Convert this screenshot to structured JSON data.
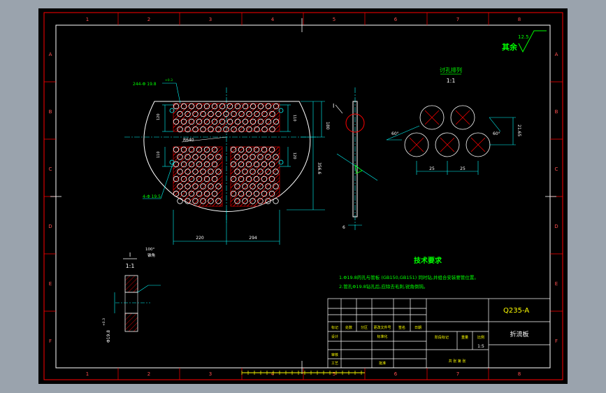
{
  "colors": {
    "background": "#000000",
    "outer_frame": "#ff0000",
    "drawing": "#ffffff",
    "dimension": "#00ffff",
    "text_green": "#00ff00",
    "text_yellow": "#ffff00",
    "hatch": "#ff0000",
    "center_line": "#00ffff",
    "page": "#9aa3ad"
  },
  "border": {
    "col_labels_top": [
      "1",
      "2",
      "3",
      "4",
      "5",
      "6",
      "7",
      "8"
    ],
    "col_labels_bottom": [
      "1",
      "2",
      "3",
      "4",
      "5",
      "6",
      "7",
      "8"
    ],
    "row_labels_left": [
      "A",
      "B",
      "C",
      "D",
      "E",
      "F"
    ],
    "row_labels_right": [
      "A",
      "B",
      "C",
      "D",
      "E",
      "F"
    ]
  },
  "roughness": {
    "prefix": "其余",
    "value": "12.5"
  },
  "main_view": {
    "callout_holes_top": "244-Φ 19.8",
    "callout_holes_top_tol": "+0.3",
    "callout_holes_bottom": "4-Φ 19.5",
    "center_label": "R640",
    "dim_width_left": "220",
    "dim_width_right": "294",
    "dim_height_right": "180",
    "dim_height_total": "356.6",
    "dim_small_1": "120",
    "dim_small_2": "110",
    "dim_small_3": "110",
    "dim_small_4": "120"
  },
  "side_view": {
    "label": "I",
    "thickness": "6"
  },
  "hole_detail": {
    "title": "讨孔排列",
    "scale": "1:1",
    "angle_left": "60°",
    "angle_right": "60°",
    "pitch_1": "25",
    "pitch_2": "25",
    "row_pitch": "21.65"
  },
  "detail_i": {
    "label": "I",
    "scale": "1:1",
    "angle": "100°",
    "angle_note": "锥角",
    "dia": "Φ19.8",
    "dia_tol": "+0.3"
  },
  "tech_requirements": {
    "title": "技术要求",
    "items": [
      "1.Φ19.8的孔与管板 (GB150,GB151) 同时钻,并组合安装要管位置。",
      "2.管孔Φ19.8钻孔后,应除去毛刺,锐角倒钝。"
    ]
  },
  "title_block": {
    "material": "Q235-A",
    "part_name": "折流板",
    "scale": "1:5",
    "headers": [
      "标记",
      "处数",
      "分区",
      "更改文件号",
      "签名",
      "日期"
    ],
    "label_design": "设计",
    "label_standard": "标准化",
    "label_review": "审核",
    "label_process": "工艺",
    "label_approve": "批准",
    "label_stage": "阶段标记",
    "label_weight": "重量",
    "label_ratio": "比例",
    "label_sheets": "共  张  第  张"
  }
}
